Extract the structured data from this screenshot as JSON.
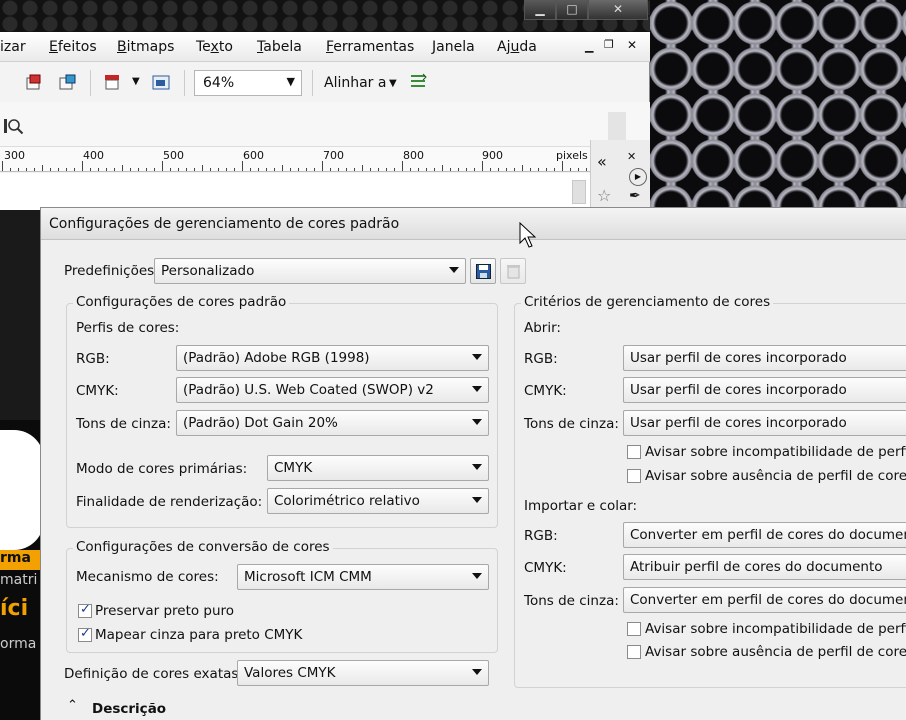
{
  "menubar": {
    "items": [
      {
        "pre": "",
        "u": "i",
        "post": "zar",
        "full": "izar"
      },
      {
        "pre": "",
        "u": "E",
        "post": "feitos"
      },
      {
        "pre": "",
        "u": "B",
        "post": "itmaps"
      },
      {
        "pre": "Te",
        "u": "x",
        "post": "to"
      },
      {
        "pre": "",
        "u": "T",
        "post": "abela"
      },
      {
        "pre": "",
        "u": "F",
        "post": "erramentas"
      },
      {
        "pre": "",
        "u": "J",
        "post": "anela"
      },
      {
        "pre": "Aj",
        "u": "u",
        "post": "da"
      }
    ]
  },
  "toolbar": {
    "zoom_value": "64%",
    "align_label": "Alinhar a"
  },
  "ruler": {
    "labels": [
      "300",
      "400",
      "500",
      "600",
      "700",
      "800",
      "900",
      "pixels"
    ]
  },
  "dialog": {
    "title": "Configurações de gerenciamento de cores padrão",
    "presets_label": "Predefinições:",
    "presets_value": "Personalizado",
    "default_group": {
      "title": "Configurações de cores padrão",
      "profiles_label": "Perfis de cores:",
      "rgb_label": "RGB:",
      "rgb_value": "(Padrão) Adobe RGB (1998)",
      "cmyk_label": "CMYK:",
      "cmyk_value": "(Padrão) U.S. Web Coated (SWOP) v2",
      "gray_label": "Tons de cinza:",
      "gray_value": "(Padrão) Dot Gain 20%",
      "primary_mode_label": "Modo de cores primárias:",
      "primary_mode_value": "CMYK",
      "rendering_label": "Finalidade de renderização:",
      "rendering_value": "Colorimétrico relativo"
    },
    "conversion_group": {
      "title": "Configurações de conversão de cores",
      "engine_label": "Mecanismo de cores:",
      "engine_value": "Microsoft ICM CMM",
      "preserve_black_label": "Preservar preto puro",
      "preserve_black_checked": true,
      "map_gray_label": "Mapear cinza para preto CMYK",
      "map_gray_checked": true
    },
    "spot_label": "Definição de cores exatas:",
    "spot_value": "Valores CMYK",
    "description_label": "Descrição",
    "policies_group": {
      "title": "Critérios de gerenciamento de cores",
      "open_label": "Abrir:",
      "open_rgb_label": "RGB:",
      "open_rgb_value": "Usar perfil de cores incorporado",
      "open_cmyk_label": "CMYK:",
      "open_cmyk_value": "Usar perfil de cores incorporado",
      "open_gray_label": "Tons de cinza:",
      "open_gray_value": "Usar perfil de cores incorporado",
      "open_warn_mismatch": "Avisar sobre incompatibilidade de perfis de c",
      "open_warn_missing": "Avisar sobre ausência de perfil de cores",
      "import_label": "Importar e colar:",
      "import_rgb_label": "RGB:",
      "import_rgb_value": "Converter em perfil de cores do documento",
      "import_cmyk_label": "CMYK:",
      "import_cmyk_value": "Atribuir perfil de cores do documento",
      "import_gray_label": "Tons de cinza:",
      "import_gray_value": "Converter em perfil de cores do documento",
      "import_warn_mismatch": "Avisar sobre incompatibilidade de perfis de c",
      "import_warn_missing": "Avisar sobre ausência de perfil de cores"
    }
  },
  "poster": {
    "fragments": [
      "rma",
      "matri",
      "íci",
      "orma"
    ]
  }
}
